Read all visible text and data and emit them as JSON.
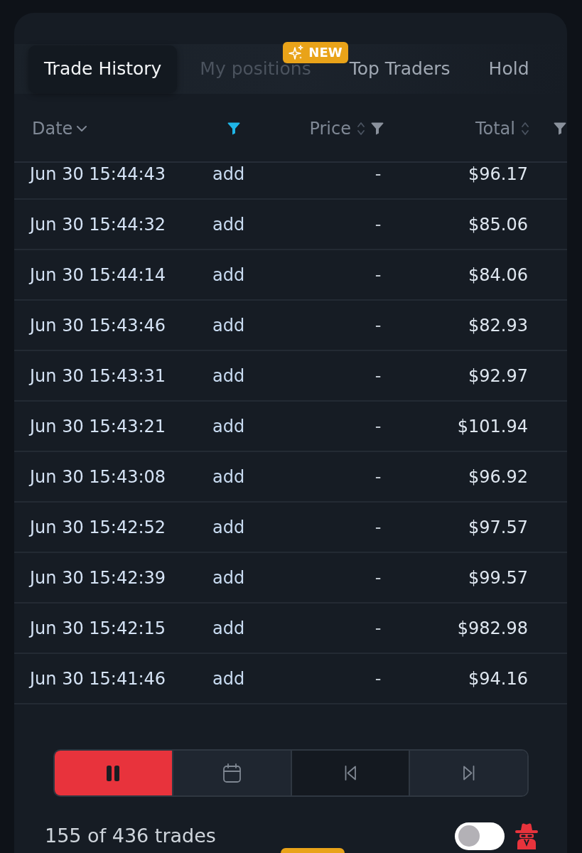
{
  "tabs": [
    {
      "label": "Trade History",
      "selected": true,
      "disabled": false
    },
    {
      "label": "My positions",
      "selected": false,
      "disabled": true,
      "badge": "NEW"
    },
    {
      "label": "Top Traders",
      "selected": false,
      "disabled": false
    },
    {
      "label": "Hold",
      "selected": false,
      "disabled": false
    }
  ],
  "table": {
    "columns": [
      {
        "label": "Date",
        "sortable": true,
        "sorted": true,
        "filterable": false,
        "filtered": false
      },
      {
        "sortable": false,
        "sorted": false,
        "filterable": true,
        "filtered": true
      },
      {
        "label": "Price",
        "sortable": true,
        "sorted": false,
        "filterable": true,
        "filtered": false
      },
      {
        "label": "Total",
        "sortable": true,
        "sorted": false,
        "filterable": false,
        "filtered": false
      },
      {
        "sortable": false,
        "sorted": false,
        "filterable": true,
        "filtered": false
      }
    ],
    "rows": [
      {
        "date": "Jun 30 15:44:43",
        "column_2": "add",
        "price": "-",
        "total": "$96.17"
      },
      {
        "date": "Jun 30 15:44:32",
        "column_2": "add",
        "price": "-",
        "total": "$85.06"
      },
      {
        "date": "Jun 30 15:44:14",
        "column_2": "add",
        "price": "-",
        "total": "$84.06"
      },
      {
        "date": "Jun 30 15:43:46",
        "column_2": "add",
        "price": "-",
        "total": "$82.93"
      },
      {
        "date": "Jun 30 15:43:31",
        "column_2": "add",
        "price": "-",
        "total": "$92.97"
      },
      {
        "date": "Jun 30 15:43:21",
        "column_2": "add",
        "price": "-",
        "total": "$101.94"
      },
      {
        "date": "Jun 30 15:43:08",
        "column_2": "add",
        "price": "-",
        "total": "$96.92"
      },
      {
        "date": "Jun 30 15:42:52",
        "column_2": "add",
        "price": "-",
        "total": "$97.57"
      },
      {
        "date": "Jun 30 15:42:39",
        "column_2": "add",
        "price": "-",
        "total": "$99.57"
      },
      {
        "date": "Jun 30 15:42:15",
        "column_2": "add",
        "price": "-",
        "total": "$982.98"
      },
      {
        "date": "Jun 30 15:41:46",
        "column_2": "add",
        "price": "-",
        "total": "$94.16"
      }
    ]
  },
  "playback_controls": [
    {
      "kind": "pause",
      "active": true,
      "pressed": false
    },
    {
      "kind": "calendar",
      "active": false,
      "pressed": false
    },
    {
      "kind": "previous",
      "active": false,
      "pressed": true
    },
    {
      "kind": "next",
      "active": false,
      "pressed": false
    }
  ],
  "footer": {
    "count": "155 of 436 trades",
    "toggle": {
      "on": false
    }
  }
}
